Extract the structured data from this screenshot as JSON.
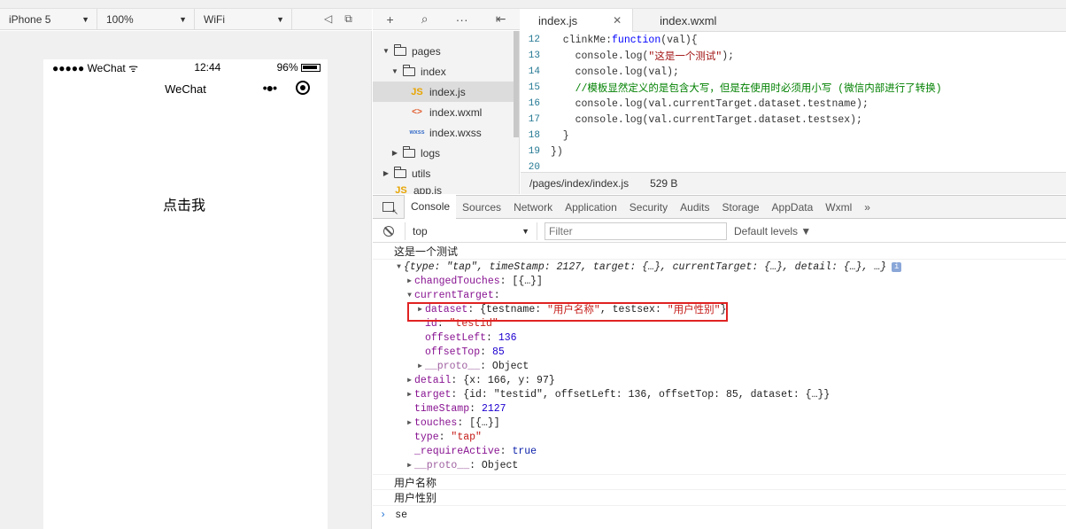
{
  "simulator_toolbar": {
    "device": "iPhone 5",
    "zoom": "100%",
    "network": "WiFi"
  },
  "phone": {
    "signal": "●●●●● WeChat",
    "time": "12:44",
    "battery": "96%",
    "nav_title": "WeChat",
    "click_text": "点击我"
  },
  "filetree": {
    "items": [
      {
        "label": "pages"
      },
      {
        "label": "index"
      },
      {
        "label": "index.js",
        "icon": "JS"
      },
      {
        "label": "index.wxml",
        "icon": "<>"
      },
      {
        "label": "index.wxss",
        "icon": "wxss"
      },
      {
        "label": "logs"
      },
      {
        "label": "utils"
      },
      {
        "label": "app.js",
        "icon": "JS"
      }
    ]
  },
  "editor": {
    "tabs": [
      {
        "label": "index.js",
        "close": "✕"
      },
      {
        "label": "index.wxml"
      }
    ],
    "lines": [
      {
        "num": "12",
        "prefix": "  clinkMe:",
        "kw": "function",
        "rest": "(val){"
      },
      {
        "num": "13",
        "code": "    console.log(",
        "str": "\"这是一个测试\"",
        "tail": ");"
      },
      {
        "num": "14",
        "code": "    console.log(val);"
      },
      {
        "num": "15",
        "comment": "    //模板显然定义的是包含大写，但是在使用时必须用小写 (微信内部进行了转换)"
      },
      {
        "num": "16",
        "code": "    console.log(val.currentTarget.dataset.testname);"
      },
      {
        "num": "17",
        "code": "    console.log(val.currentTarget.dataset.testsex);"
      },
      {
        "num": "18",
        "code": "  }"
      },
      {
        "num": "19",
        "code": "})"
      },
      {
        "num": "20",
        "code": ""
      }
    ],
    "status_path": "/pages/index/index.js",
    "status_size": "529 B"
  },
  "devtools": {
    "tabs": [
      "Console",
      "Sources",
      "Network",
      "Application",
      "Security",
      "Audits",
      "Storage",
      "AppData",
      "Wxml",
      "»"
    ],
    "context": "top",
    "filter_placeholder": "Filter",
    "levels": "Default levels ▼"
  },
  "console": {
    "msg1": "这是一个测试",
    "obj_summary": "{type: \"tap\", timeStamp: 2127, target: {…}, currentTarget: {…}, detail: {…}, …}",
    "changedTouches_key": "changedTouches",
    "changedTouches_val": ": [{…}]",
    "currentTarget_key": "currentTarget",
    "dataset_key": "dataset",
    "dataset_val_pre": ": {testname: ",
    "dataset_name": "\"用户名称\"",
    "dataset_mid": ", testsex: ",
    "dataset_sex": "\"用户性别\"",
    "dataset_end": "}",
    "id_key": "id",
    "id_val": "\"testid\"",
    "offsetLeft_key": "offsetLeft",
    "offsetLeft_val": "136",
    "offsetTop_key": "offsetTop",
    "offsetTop_val": "85",
    "proto_key": "__proto__",
    "proto_val": ": Object",
    "detail_key": "detail",
    "detail_val": ": {x: 166, y: 97}",
    "target_key": "target",
    "target_val": ": {id: \"testid\", offsetLeft: 136, offsetTop: 85, dataset: {…}}",
    "timeStamp_key": "timeStamp",
    "timeStamp_val": "2127",
    "touches_key": "touches",
    "touches_val": ": [{…}]",
    "type_key": "type",
    "type_val": "\"tap\"",
    "requireActive_key": "_requireActive",
    "requireActive_val": "true",
    "proto2_key": "__proto__",
    "proto2_val": ": Object",
    "msg2": "用户名称",
    "msg3": "用户性别",
    "input": "se"
  }
}
